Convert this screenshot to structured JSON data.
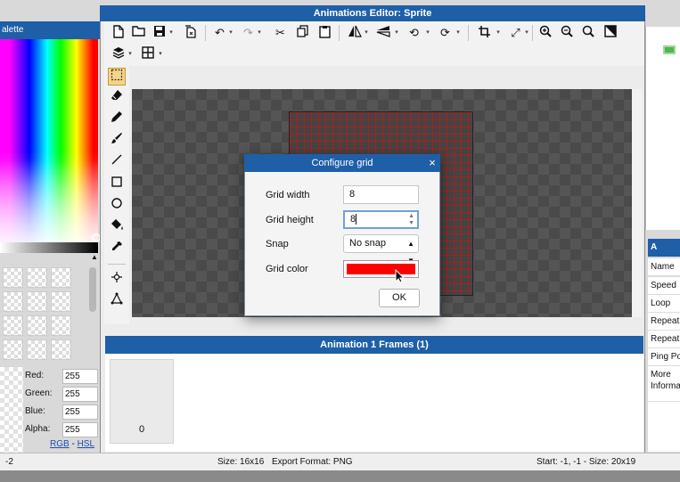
{
  "palette": {
    "title": "alette",
    "rgb": [
      {
        "label": "Red:",
        "value": "255"
      },
      {
        "label": "Green:",
        "value": "255"
      },
      {
        "label": "Blue:",
        "value": "255"
      },
      {
        "label": "Alpha:",
        "value": "255"
      }
    ],
    "mode_rgb": "RGB",
    "mode_sep": " - ",
    "mode_hsl": "HSL"
  },
  "window": {
    "title": "Animations Editor: Sprite"
  },
  "toolbar": {
    "row1": [
      "new-file-icon",
      "open-folder-icon",
      "save-icon",
      "export-icon",
      "undo-icon",
      "redo-icon",
      "cut-icon",
      "copy-icon",
      "paste-icon",
      "flip-horizontal-icon",
      "flip-vertical-icon",
      "rotate-ccw-icon",
      "rotate-cw-icon",
      "crop-icon",
      "resize-icon",
      "zoom-in-icon",
      "zoom-out-icon",
      "zoom-fit-icon",
      "fullscreen-icon"
    ],
    "row2": [
      "layers-icon",
      "grid-icon"
    ]
  },
  "tools": [
    "select-icon",
    "eraser-icon",
    "pencil-icon",
    "brush-icon",
    "line-icon",
    "rectangle-icon",
    "ellipse-icon",
    "fill-icon",
    "eyedropper-icon",
    "point-icon",
    "polygon-icon"
  ],
  "frames": {
    "title": "Animation 1 Frames (1)",
    "items": [
      {
        "number": "0"
      }
    ]
  },
  "properties": {
    "items": [
      "Name",
      "Speed",
      "Loop",
      "Repeat",
      "Repeat",
      "Ping Po",
      "More\nInforma"
    ]
  },
  "status": {
    "left": "-2",
    "size": "Size: 16x16",
    "format": "Export Format: PNG",
    "selection": "Start: -1, -1 - Size: 20x19"
  },
  "dialog": {
    "title": "Configure grid",
    "close": "×",
    "grid_width_label": "Grid width",
    "grid_width_value": "8",
    "grid_height_label": "Grid height",
    "grid_height_value": "8",
    "snap_label": "Snap",
    "snap_value": "No snap",
    "grid_color_label": "Grid color",
    "grid_color": "#ff0000",
    "ok_label": "OK"
  },
  "colors": {
    "title_bar": "#1e5fa8",
    "accent_select": "#f5d48a"
  }
}
